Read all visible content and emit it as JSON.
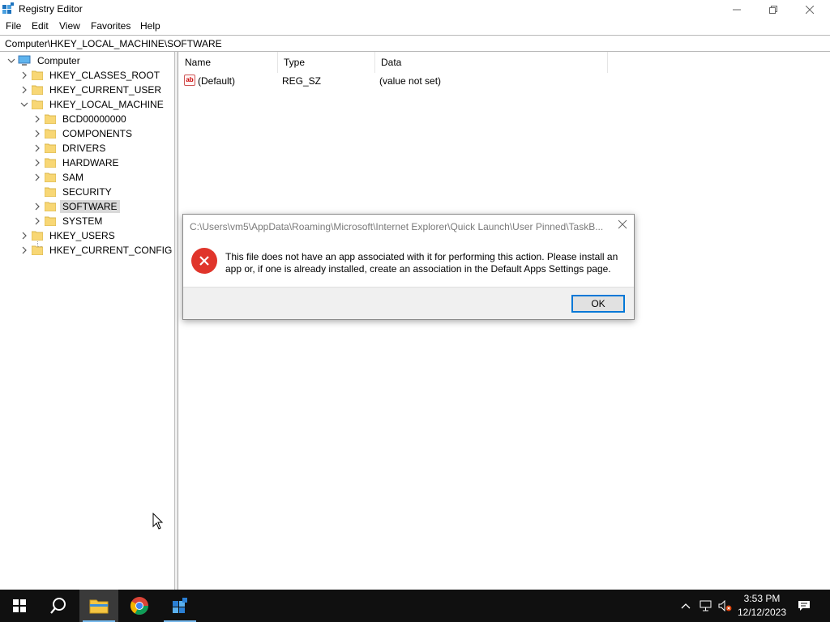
{
  "window": {
    "title": "Registry Editor",
    "menu": [
      "File",
      "Edit",
      "View",
      "Favorites",
      "Help"
    ]
  },
  "address": "Computer\\HKEY_LOCAL_MACHINE\\SOFTWARE",
  "tree": {
    "root": "Computer",
    "hives": [
      "HKEY_CLASSES_ROOT",
      "HKEY_CURRENT_USER",
      "HKEY_LOCAL_MACHINE",
      "HKEY_USERS",
      "HKEY_CURRENT_CONFIG"
    ],
    "hklm_children": [
      "BCD00000000",
      "COMPONENTS",
      "DRIVERS",
      "HARDWARE",
      "SAM",
      "SECURITY",
      "SOFTWARE",
      "SYSTEM"
    ],
    "selected": "SOFTWARE"
  },
  "list": {
    "columns": [
      "Name",
      "Type",
      "Data"
    ],
    "rows": [
      {
        "name": "(Default)",
        "type": "REG_SZ",
        "data": "(value not set)",
        "icon": "string-value-icon"
      }
    ]
  },
  "dialog": {
    "title": "C:\\Users\\vm5\\AppData\\Roaming\\Microsoft\\Internet Explorer\\Quick Launch\\User Pinned\\TaskB...",
    "message": "This file does not have an app associated with it for performing this action. Please install an app or, if one is already installed, create an association in the Default Apps Settings page.",
    "ok_label": "OK",
    "icon": "error-icon"
  },
  "taskbar": {
    "apps": [
      "start-icon",
      "search-icon",
      "file-explorer-icon",
      "chrome-icon",
      "registry-editor-icon"
    ],
    "time": "3:53 PM",
    "date": "12/12/2023"
  },
  "colors": {
    "error": "#e0352b",
    "accent": "#0078d7",
    "folder": "#f8d775",
    "taskbar": "#101010"
  }
}
